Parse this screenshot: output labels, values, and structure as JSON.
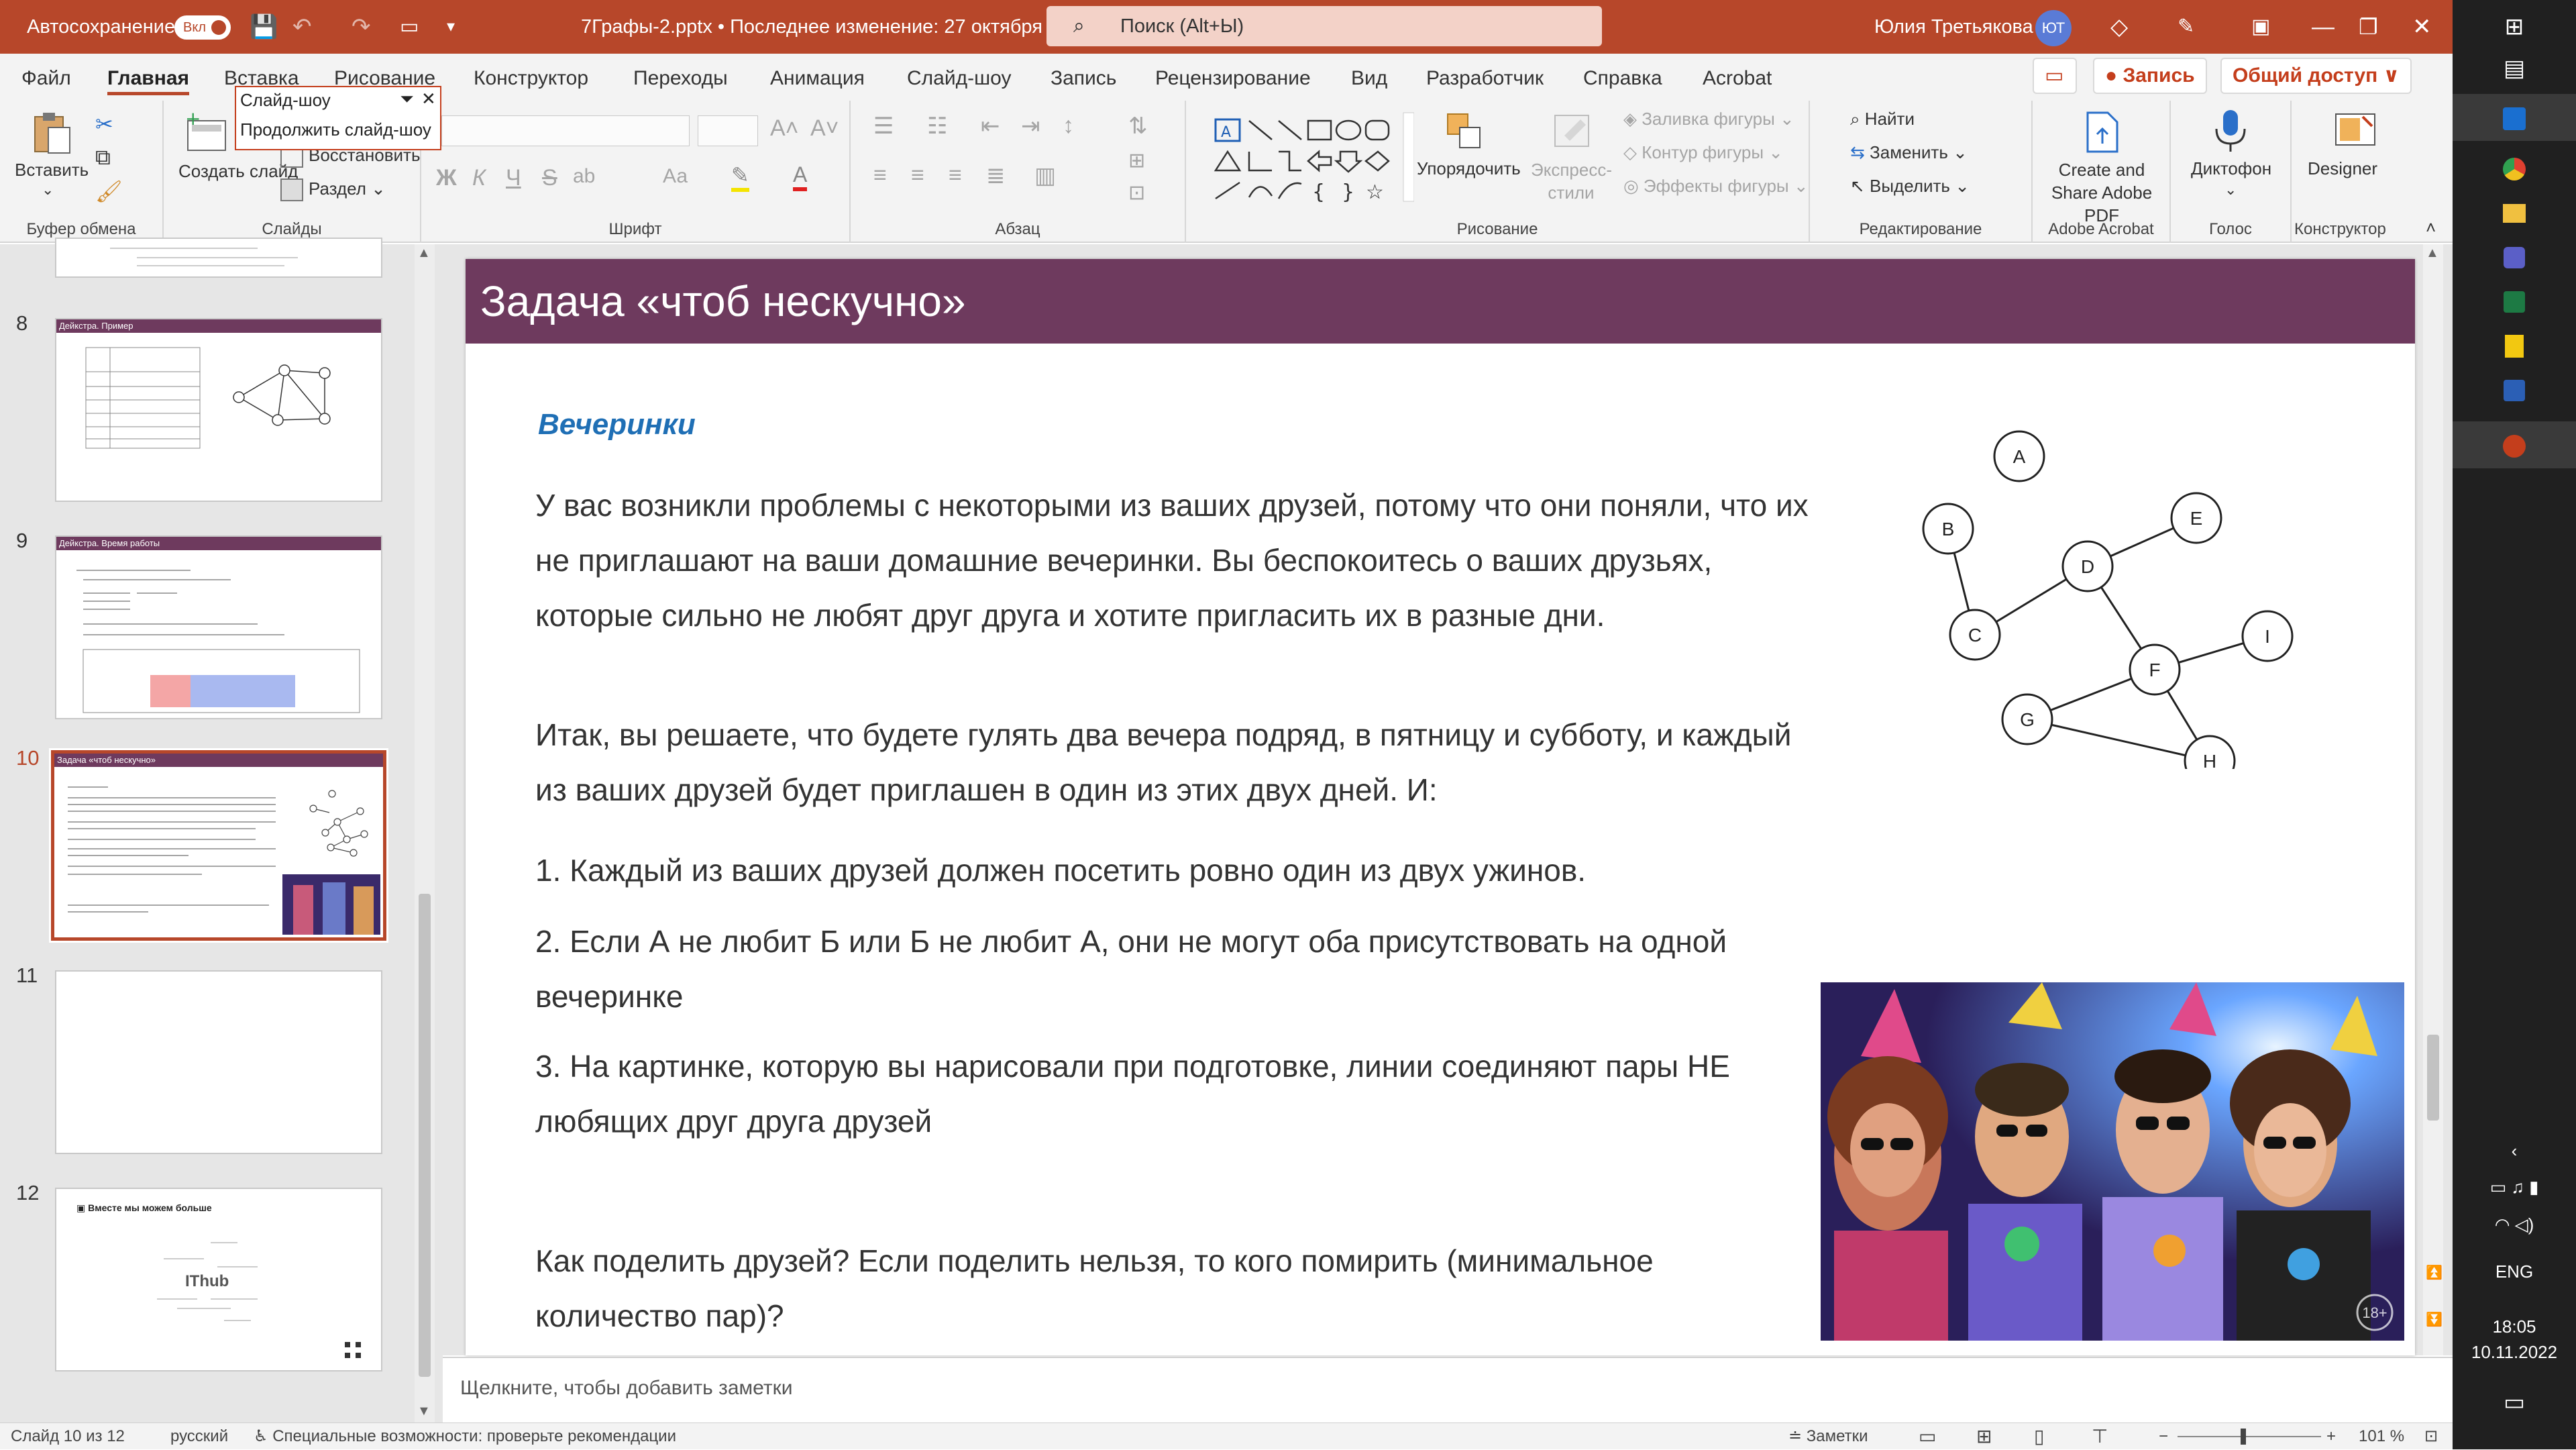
{
  "titlebar": {
    "autosave_label": "Автосохранение",
    "autosave_state": "Вкл",
    "doc_title": "7Графы-2.pptx • Последнее изменение: 27 октября ∨",
    "search_placeholder": "Поиск (Alt+Ы)",
    "user_name": "Юлия Третьякова",
    "user_initials": "ЮТ"
  },
  "tabs": [
    "Файл",
    "Главная",
    "Вставка",
    "Рисование",
    "Конструктор",
    "Переходы",
    "Анимация",
    "Слайд-шоу",
    "Запись",
    "Рецензирование",
    "Вид",
    "Разработчик",
    "Справка",
    "Acrobat"
  ],
  "header_buttons": {
    "record": "● Запись",
    "share": "Общий доступ ∨"
  },
  "popup": {
    "item1": "Слайд-шоу",
    "item2": "Продолжить слайд-шоу"
  },
  "ribbon": {
    "clipboard": {
      "paste": "Вставить",
      "label": "Буфер обмена"
    },
    "slides": {
      "create": "Создать слайд",
      "restore": "Восстановить",
      "section": "Раздел",
      "label": "Слайды"
    },
    "font": {
      "label": "Шрифт",
      "bold": "Ж",
      "italic": "К",
      "underline": "Ч",
      "strike": "S",
      "shadow": "ab",
      "case": "Аа"
    },
    "paragraph": {
      "label": "Абзац"
    },
    "drawing": {
      "arrange": "Упорядочить",
      "styles": "Экспресс-стили",
      "fill": "Заливка фигуры",
      "outline": "Контур фигуры",
      "effects": "Эффекты фигуры",
      "label": "Рисование"
    },
    "editing": {
      "find": "Найти",
      "replace": "Заменить",
      "select": "Выделить",
      "label": "Редактирование"
    },
    "acrobat": {
      "create": "Create and Share Adobe PDF",
      "label": "Adobe Acrobat"
    },
    "voice": {
      "dictate": "Диктофон",
      "label": "Голос"
    },
    "designer": {
      "button": "Designer",
      "label": "Конструктор"
    }
  },
  "thumbnails": [
    {
      "num": "8",
      "title": "Дейкстра. Пример"
    },
    {
      "num": "9",
      "title": "Дейкстра. Время работы"
    },
    {
      "num": "10",
      "title": "Задача «чтоб нескучно»"
    },
    {
      "num": "11",
      "title": ""
    },
    {
      "num": "12",
      "title": "Вместе мы можем больше",
      "brand": "IThub"
    }
  ],
  "slide": {
    "title": "Задача «чтоб нескучно»",
    "subheading": "Вечеринки",
    "p1": "У вас возникли проблемы с некоторыми из ваших друзей, потому что они поняли, что их не приглашают на ваши домашние вечеринки. Вы беспокоитесь о ваших друзьях, которые сильно не любят друг друга и хотите пригласить их в разные дни.",
    "p2": "Итак, вы решаете, что будете гулять два вечера подряд, в пятницу и субботу, и каждый из ваших друзей будет приглашен в один из этих двух дней. И:",
    "p3": "1. Каждый из ваших друзей должен посетить ровно один из двух ужинов.",
    "p4": "2. Если А не любит Б или Б не любит А, они не могут оба присутствовать на одной вечеринке",
    "p5": "3. На картинке, которую вы нарисовали при подготовке, линии соединяют пары НЕ любящих друг друга друзей",
    "p6": "Как поделить друзей? Если поделить нельзя, то кого помирить (минимальное количество пар)?",
    "graph_nodes": [
      "A",
      "B",
      "C",
      "D",
      "E",
      "F",
      "G",
      "H",
      "I"
    ],
    "photo_badge": "18+"
  },
  "notes_placeholder": "Щелкните, чтобы добавить заметки",
  "status": {
    "slide_pos": "Слайд 10 из 12",
    "language": "русский",
    "accessibility": "Специальные возможности: проверьте рекомендации",
    "notes": "Заметки",
    "zoom": "101 %"
  },
  "taskbar": {
    "lang": "ENG",
    "time": "18:05",
    "date": "10.11.2022"
  }
}
